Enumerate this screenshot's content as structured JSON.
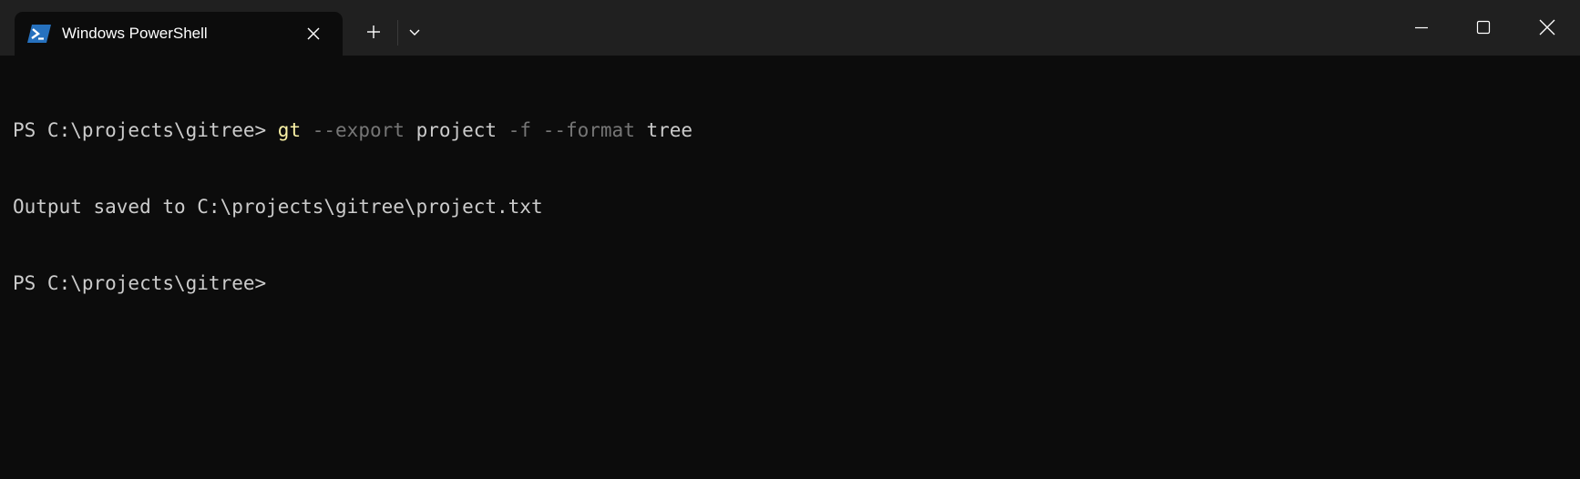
{
  "window": {
    "tab_title": "Windows PowerShell",
    "tab_icon": "powershell-icon",
    "new_tab_icon": "plus-icon",
    "dropdown_icon": "chevron-down-icon",
    "caption": {
      "minimize_icon": "minimize-icon",
      "maximize_icon": "maximize-icon",
      "close_icon": "close-icon"
    }
  },
  "colors": {
    "background": "#0c0c0c",
    "titlebar": "#202020",
    "text": "#cccccc",
    "command": "#f9f1a5",
    "parameter": "#767676",
    "powershell_blue": "#2671be"
  },
  "terminal": {
    "lines": [
      {
        "prompt": "PS C:\\projects\\gitree> ",
        "command": "gt",
        "tokens": [
          " ",
          "--export",
          " ",
          "project",
          " ",
          "-f",
          " ",
          "--format",
          " ",
          "tree"
        ]
      },
      {
        "text": "Output saved to C:\\projects\\gitree\\project.txt"
      },
      {
        "prompt": "PS C:\\projects\\gitree>"
      }
    ]
  }
}
